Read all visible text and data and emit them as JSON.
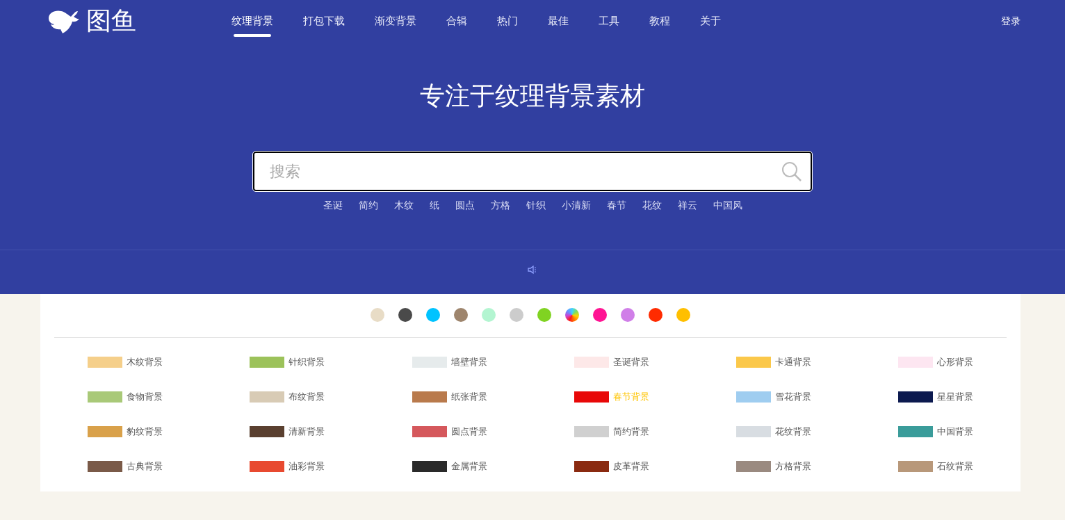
{
  "logo": {
    "text": "图鱼"
  },
  "nav": [
    {
      "label": "纹理背景",
      "selected": true
    },
    {
      "label": "打包下载",
      "selected": false
    },
    {
      "label": "渐变背景",
      "selected": false
    },
    {
      "label": "合辑",
      "selected": false
    },
    {
      "label": "热门",
      "selected": false
    },
    {
      "label": "最佳",
      "selected": false
    },
    {
      "label": "工具",
      "selected": false
    },
    {
      "label": "教程",
      "selected": false
    },
    {
      "label": "关于",
      "selected": false
    }
  ],
  "login": "登录",
  "hero": {
    "title": "专注于纹理背景素材"
  },
  "search": {
    "placeholder": "搜索"
  },
  "tags": [
    "圣诞",
    "简约",
    "木纹",
    "纸",
    "圆点",
    "方格",
    "针织",
    "小清新",
    "春节",
    "花纹",
    "祥云",
    "中国风"
  ],
  "color_filters": [
    {
      "kind": "solid",
      "color": "#e8dcc6"
    },
    {
      "kind": "solid",
      "color": "#4a4a4a"
    },
    {
      "kind": "solid",
      "color": "#00c3ff"
    },
    {
      "kind": "solid",
      "color": "#9e856d"
    },
    {
      "kind": "solid",
      "color": "#b3f5d1"
    },
    {
      "kind": "solid",
      "color": "#cccccc"
    },
    {
      "kind": "solid",
      "color": "#80d322"
    },
    {
      "kind": "multi"
    },
    {
      "kind": "solid",
      "color": "#ff1493"
    },
    {
      "kind": "solid",
      "color": "#d07fe8"
    },
    {
      "kind": "solid",
      "color": "#ff2b00"
    },
    {
      "kind": "solid",
      "color": "#ffbf00"
    }
  ],
  "categories": [
    {
      "label": "木纹背景",
      "color": "#f5cf8a",
      "highlighted": false
    },
    {
      "label": "针织背景",
      "color": "#9cc25a",
      "highlighted": false
    },
    {
      "label": "墙壁背景",
      "color": "#e6ebec",
      "highlighted": false
    },
    {
      "label": "圣诞背景",
      "color": "#fde8e8",
      "highlighted": false
    },
    {
      "label": "卡通背景",
      "color": "#fbc84a",
      "highlighted": false
    },
    {
      "label": "心形背景",
      "color": "#fde6f1",
      "highlighted": false
    },
    {
      "label": "食物背景",
      "color": "#a9c978",
      "highlighted": false
    },
    {
      "label": "布纹背景",
      "color": "#d8cbb5",
      "highlighted": false
    },
    {
      "label": "纸张背景",
      "color": "#b97a4c",
      "highlighted": false
    },
    {
      "label": "春节背景",
      "color": "#e80808",
      "highlighted": true
    },
    {
      "label": "雪花背景",
      "color": "#9fcdf0",
      "highlighted": false
    },
    {
      "label": "星星背景",
      "color": "#0c1a4f",
      "highlighted": false
    },
    {
      "label": "豹纹背景",
      "color": "#d9a14a",
      "highlighted": false
    },
    {
      "label": "清新背景",
      "color": "#5a4030",
      "highlighted": false
    },
    {
      "label": "圆点背景",
      "color": "#d5585c",
      "highlighted": false
    },
    {
      "label": "简约背景",
      "color": "#d0d0d0",
      "highlighted": false
    },
    {
      "label": "花纹背景",
      "color": "#d8dde2",
      "highlighted": false
    },
    {
      "label": "中国背景",
      "color": "#3a9c9a",
      "highlighted": false
    },
    {
      "label": "古典背景",
      "color": "#7a5a48",
      "highlighted": false
    },
    {
      "label": "油彩背景",
      "color": "#e84a30",
      "highlighted": false
    },
    {
      "label": "金属背景",
      "color": "#2a2a2a",
      "highlighted": false
    },
    {
      "label": "皮革背景",
      "color": "#8a2a10",
      "highlighted": false
    },
    {
      "label": "方格背景",
      "color": "#9a8a80",
      "highlighted": false
    },
    {
      "label": "石纹背景",
      "color": "#b8987a",
      "highlighted": false
    }
  ]
}
